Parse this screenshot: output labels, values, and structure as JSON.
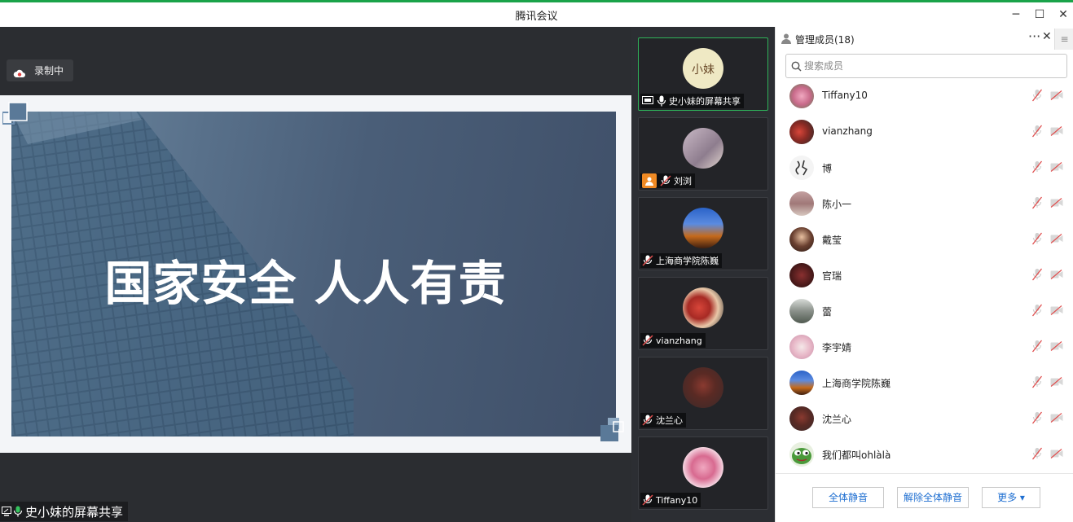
{
  "window": {
    "title": "腾讯会议",
    "controls": {
      "minimize": "─",
      "maximize": "☐",
      "close": "✕"
    }
  },
  "stage": {
    "recording_label": "录制中",
    "slide_title": "国家安全 人人有责",
    "share_label": "史小妹的屏幕共享"
  },
  "thumbnails": [
    {
      "name": "史小妹的屏幕共享",
      "active": true,
      "icon": "screen-share-icon"
    },
    {
      "name": "刘浏",
      "active": false,
      "icon": "mic-muted-icon"
    },
    {
      "name": "上海商学院陈巍",
      "active": false,
      "icon": "mic-muted-icon"
    },
    {
      "name": "vianzhang",
      "active": false,
      "icon": "mic-muted-icon"
    },
    {
      "name": "沈兰心",
      "active": false,
      "icon": "mic-muted-icon"
    },
    {
      "name": "Tiffany10",
      "active": false,
      "icon": "mic-muted-icon"
    }
  ],
  "panel": {
    "title": "管理成员(18)",
    "more": "···",
    "close": "✕",
    "side": "≡",
    "search_placeholder": "搜索成员",
    "members": [
      {
        "name": "Tiffany10"
      },
      {
        "name": "vianzhang"
      },
      {
        "name": "博"
      },
      {
        "name": "陈小一"
      },
      {
        "name": "戴莹"
      },
      {
        "name": "官瑞"
      },
      {
        "name": "蕾"
      },
      {
        "name": "李宇婧"
      },
      {
        "name": "上海商学院陈巍"
      },
      {
        "name": "沈兰心"
      },
      {
        "name": "我们都叫ohlàlà"
      }
    ],
    "footer": {
      "mute_all": "全体静音",
      "unmute_all": "解除全体静音",
      "more": "更多 ▾"
    }
  },
  "colors": {
    "accent_green": "#2fb35a",
    "link_blue": "#1f6fd1",
    "muted_red": "#e05050"
  }
}
